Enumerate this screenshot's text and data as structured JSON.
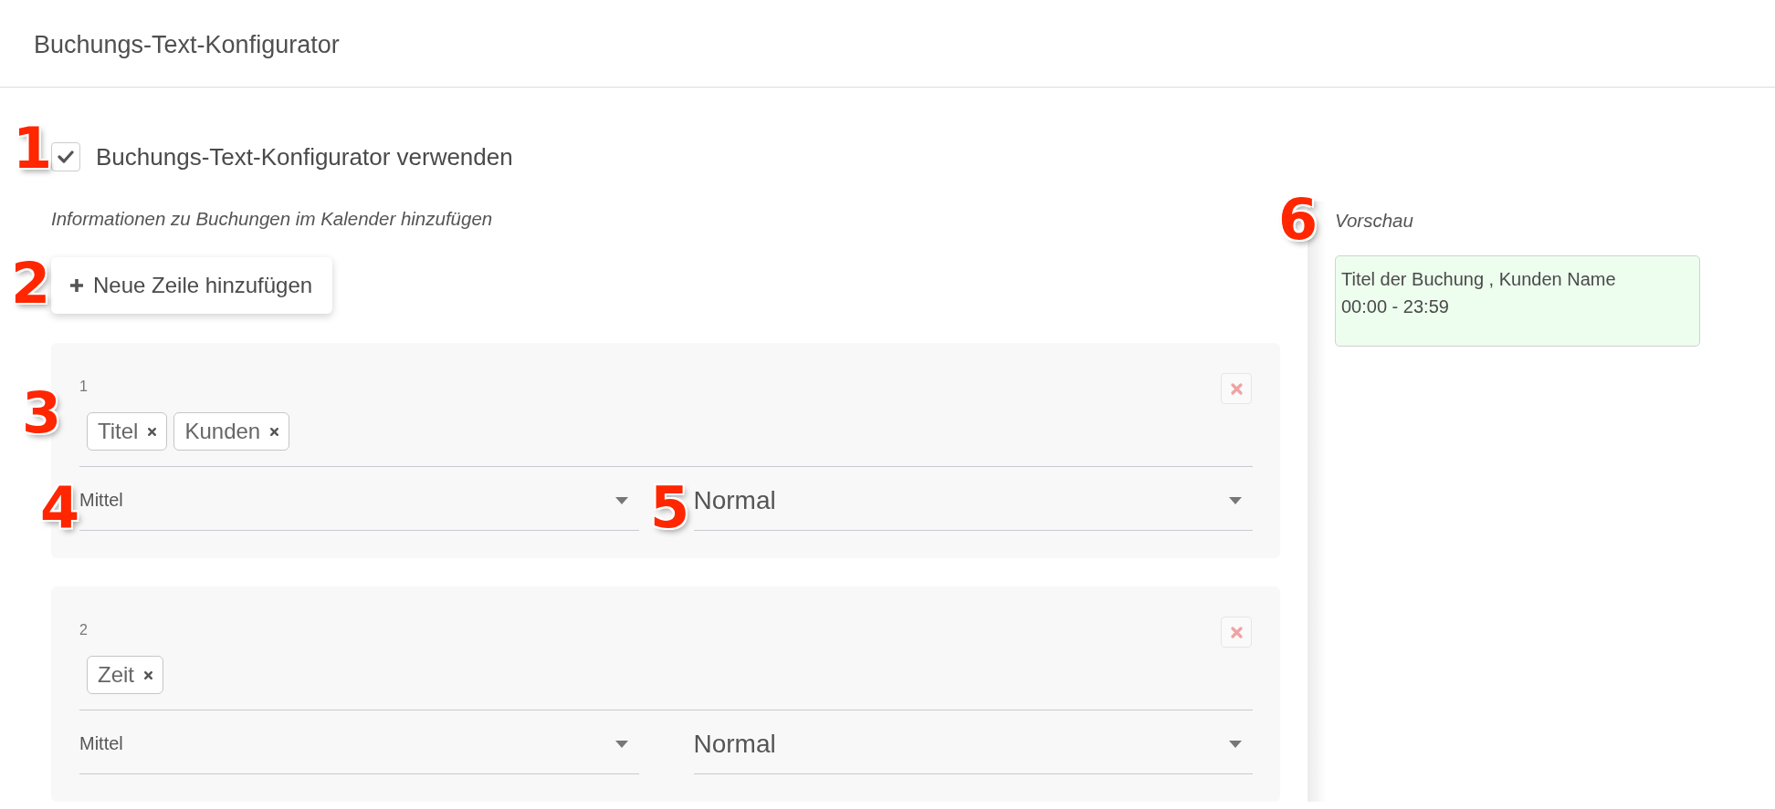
{
  "page_title": "Buchungs-Text-Konfigurator",
  "enable": {
    "label": "Buchungs-Text-Konfigurator verwenden",
    "checked": true
  },
  "hint": "Informationen zu Buchungen im Kalender hinzufügen",
  "add_button": {
    "label": "Neue Zeile hinzufügen"
  },
  "rows": [
    {
      "number": "1",
      "tags": [
        "Titel",
        "Kunden"
      ],
      "size": "Mittel",
      "style": "Normal"
    },
    {
      "number": "2",
      "tags": [
        "Zeit"
      ],
      "size": "Mittel",
      "style": "Normal"
    }
  ],
  "preview": {
    "title": "Vorschau",
    "lines": [
      "Titel der Buchung , Kunden Name",
      "00:00 - 23:59"
    ]
  },
  "annotations": [
    {
      "label": "1"
    },
    {
      "label": "2"
    },
    {
      "label": "3"
    },
    {
      "label": "4"
    },
    {
      "label": "5"
    },
    {
      "label": "6"
    }
  ]
}
